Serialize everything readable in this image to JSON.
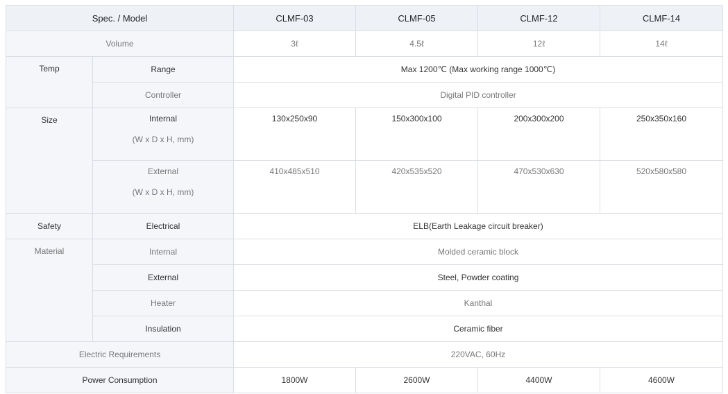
{
  "header": {
    "spec_model": "Spec. / Model",
    "models": [
      "CLMF-03",
      "CLMF-05",
      "CLMF-12",
      "CLMF-14"
    ]
  },
  "rows": {
    "volume": {
      "label": "Volume",
      "values": [
        "3ℓ",
        "4.5ℓ",
        "12ℓ",
        "14ℓ"
      ]
    },
    "temp": {
      "label": "Temp",
      "range": {
        "label": "Range",
        "value": "Max 1200℃ (Max working range 1000℃)"
      },
      "controller": {
        "label": "Controller",
        "value": "Digital PID controller"
      }
    },
    "size": {
      "label": "Size",
      "internal": {
        "label": "Internal",
        "unit": "(W x D x H, mm)",
        "values": [
          "130x250x90",
          "150x300x100",
          "200x300x200",
          "250x350x160"
        ]
      },
      "external": {
        "label": "External",
        "unit": "(W x D x H, mm)",
        "values": [
          "410x485x510",
          "420x535x520",
          "470x530x630",
          "520x580x580"
        ]
      }
    },
    "safety": {
      "label": "Safety",
      "electrical": {
        "label": "Electrical",
        "value": "ELB(Earth Leakage circuit breaker)"
      }
    },
    "material": {
      "label": "Material",
      "internal": {
        "label": "Internal",
        "value": "Molded ceramic block"
      },
      "external": {
        "label": "External",
        "value": "Steel, Powder coating"
      },
      "heater": {
        "label": "Heater",
        "value": "Kanthal"
      },
      "insulation": {
        "label": "Insulation",
        "value": "Ceramic fiber"
      }
    },
    "electric": {
      "label": "Electric Requirements",
      "value": "220VAC, 60Hz"
    },
    "power": {
      "label": "Power Consumption",
      "values": [
        "1800W",
        "2600W",
        "4400W",
        "4600W"
      ]
    }
  }
}
